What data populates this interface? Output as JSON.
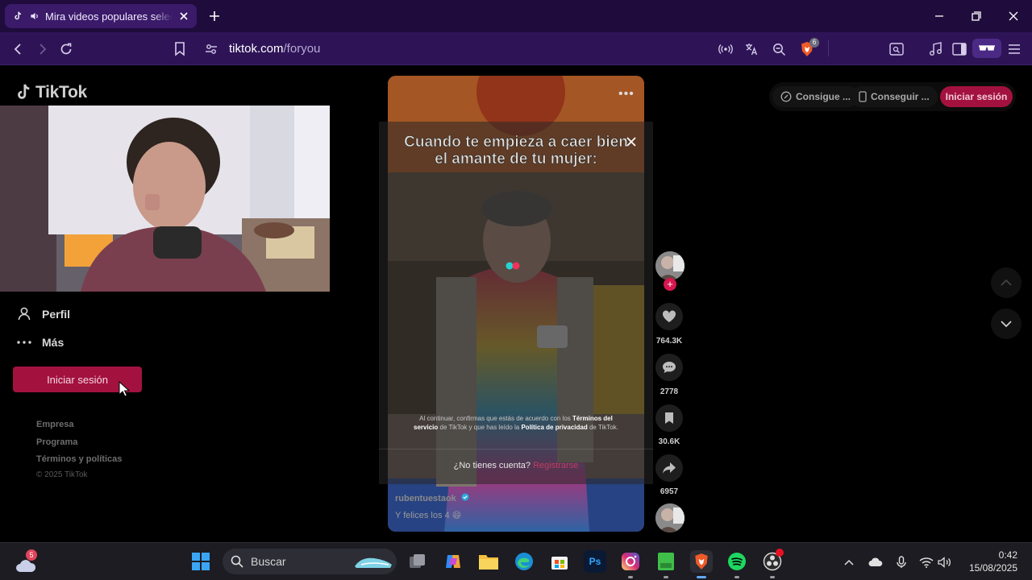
{
  "browser": {
    "tab_title": "Mira videos populares selecc",
    "url_host": "tiktok.com",
    "url_path": "/foryou",
    "brave_badge": "6"
  },
  "sidebar": {
    "logo_text": "TikTok",
    "nav": [
      {
        "label": "Perfil",
        "icon": "person-icon"
      },
      {
        "label": "Más",
        "icon": "more-dots-icon"
      }
    ],
    "login_label": "Iniciar sesión",
    "footer": {
      "empresa": "Empresa",
      "programa": "Programa",
      "terminos": "Términos y políticas",
      "copyright": "© 2025 TikTok"
    }
  },
  "video": {
    "caption": "Cuando te empieza a caer bien el amante de tu mujer:",
    "legal_prefix": "Al continuar, confirmas que estás de acuerdo con los",
    "legal_terms": "Términos del servicio",
    "legal_mid1": "de TikTok y que has leído la",
    "legal_privacy": "Política de privacidad",
    "legal_mid2": "de TikTok.",
    "signup_question": "¿No tienes cuenta?",
    "signup_link": "Registrarse",
    "author": "rubentuestaok",
    "description": "Y felices los 4 😄"
  },
  "actions": {
    "likes": "764.3K",
    "comments": "2778",
    "saves": "30.6K",
    "shares": "6957",
    "follow_symbol": "+"
  },
  "topbar": {
    "get_coins": "Consigue ...",
    "get_app": "Conseguir ...",
    "login": "Iniciar sesión"
  },
  "taskbar": {
    "search_placeholder": "Buscar",
    "weather_badge": "5",
    "time": "0:42",
    "date": "15/08/2025"
  },
  "colors": {
    "browser_tabbar": "#1f0c3c",
    "browser_toolbar": "#2e1457",
    "tiktok_accent": "#a3123f"
  }
}
